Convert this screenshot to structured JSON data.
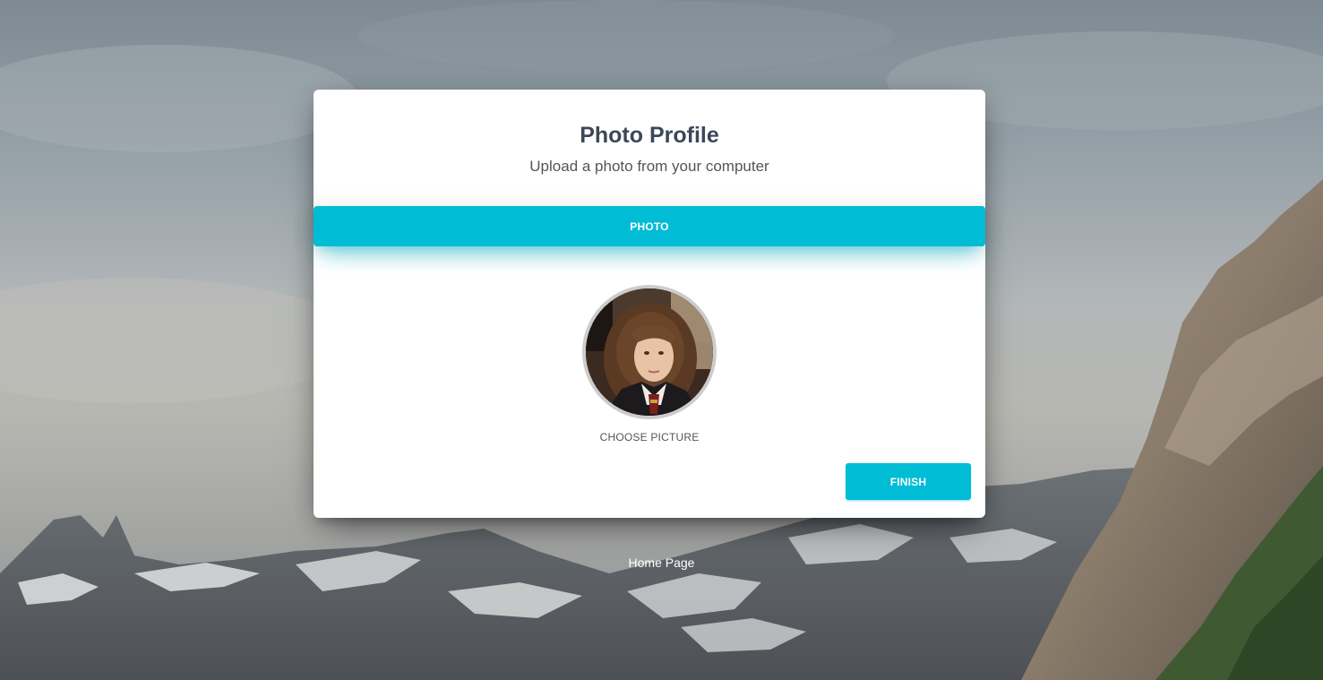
{
  "wizard": {
    "title": "Photo Profile",
    "subtitle": "Upload a photo from your computer",
    "tab_label": "PHOTO",
    "choose_picture_label": "CHOOSE PICTURE",
    "finish_label": "FINISH"
  },
  "footer": {
    "home_link_label": "Home Page"
  },
  "colors": {
    "accent": "#00bcd4",
    "title": "#3c4858",
    "avatar_border": "#cccccc"
  },
  "icons": {
    "avatar": "profile-photo"
  }
}
